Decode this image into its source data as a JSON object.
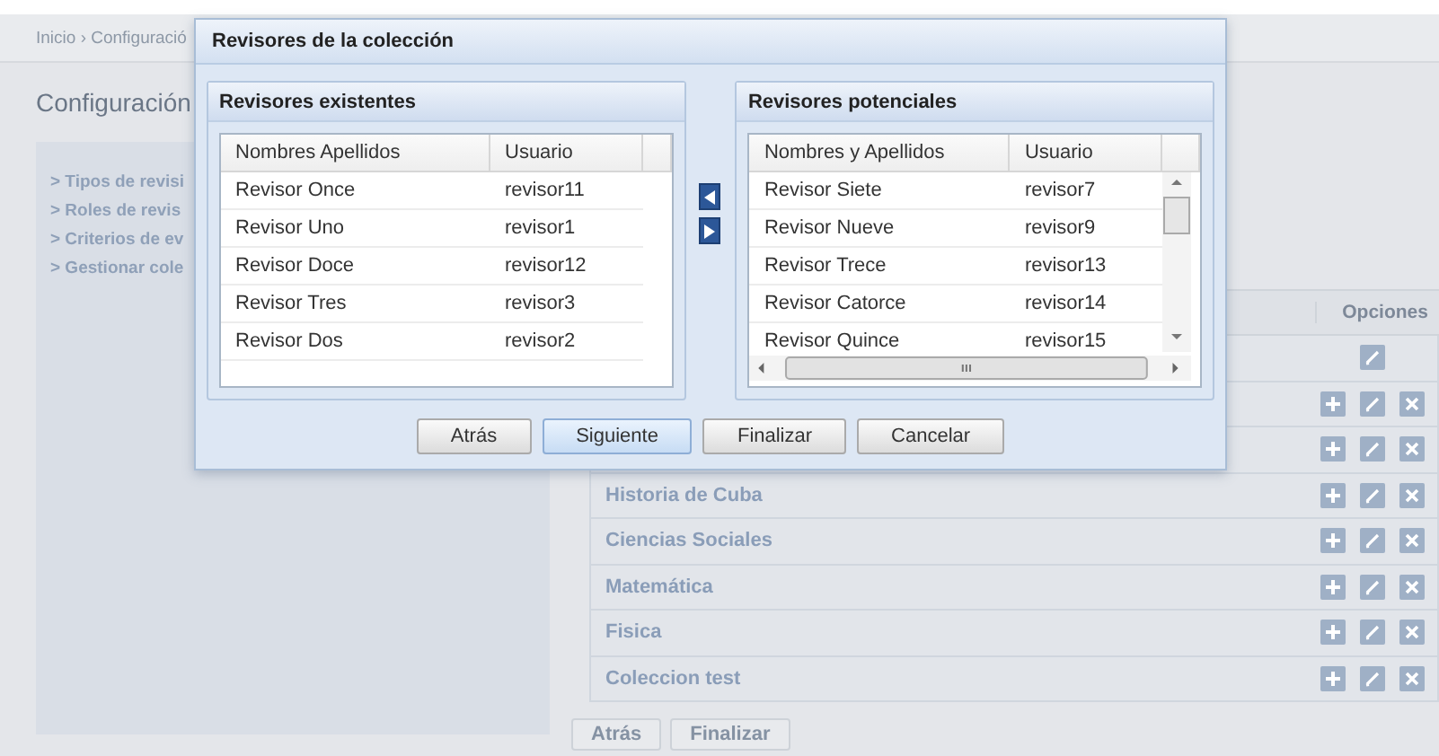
{
  "breadcrumb": "Inicio › Configuració",
  "page_title": "Configuración",
  "sidebar": {
    "items": [
      {
        "label": "> Tipos de revisi"
      },
      {
        "label": "> Roles de revis"
      },
      {
        "label": "> Criterios de ev"
      },
      {
        "label": "> Gestionar cole"
      }
    ]
  },
  "table": {
    "options_header": "Opciones",
    "rows": [
      {
        "can_add": false,
        "can_edit": true,
        "can_delete": false
      },
      {
        "can_add": true,
        "can_edit": true,
        "can_delete": true
      },
      {
        "can_add": true,
        "can_edit": true,
        "can_delete": true
      },
      {
        "name": "Historia de Cuba",
        "can_add": true,
        "can_edit": true,
        "can_delete": true
      },
      {
        "name": "Ciencias Sociales",
        "can_add": true,
        "can_edit": true,
        "can_delete": true
      },
      {
        "name": "Matemática",
        "can_add": true,
        "can_edit": true,
        "can_delete": true
      },
      {
        "name": "Fisica",
        "can_add": true,
        "can_edit": true,
        "can_delete": true
      },
      {
        "name": "Coleccion test",
        "can_add": true,
        "can_edit": true,
        "can_delete": true
      }
    ]
  },
  "page_buttons": [
    "Atrás",
    "Finalizar"
  ],
  "dialog": {
    "title": "Revisores de la colección",
    "existing": {
      "title": "Revisores existentes",
      "columns": [
        "Nombres Apellidos",
        "Usuario"
      ],
      "rows": [
        [
          "Revisor Once",
          "revisor11"
        ],
        [
          "Revisor Uno",
          "revisor1"
        ],
        [
          "Revisor Doce",
          "revisor12"
        ],
        [
          "Revisor Tres",
          "revisor3"
        ],
        [
          "Revisor Dos",
          "revisor2"
        ]
      ]
    },
    "potential": {
      "title": "Revisores potenciales",
      "columns": [
        "Nombres y Apellidos",
        "Usuario"
      ],
      "rows": [
        [
          "Revisor Siete",
          "revisor7"
        ],
        [
          "Revisor Nueve",
          "revisor9"
        ],
        [
          "Revisor Trece",
          "revisor13"
        ],
        [
          "Revisor Catorce",
          "revisor14"
        ],
        [
          "Revisor Quince",
          "revisor15"
        ]
      ]
    },
    "buttons": [
      {
        "label": "Atrás",
        "selected": false
      },
      {
        "label": "Siguiente",
        "selected": true
      },
      {
        "label": "Finalizar",
        "selected": false
      },
      {
        "label": "Cancelar",
        "selected": false
      }
    ]
  }
}
